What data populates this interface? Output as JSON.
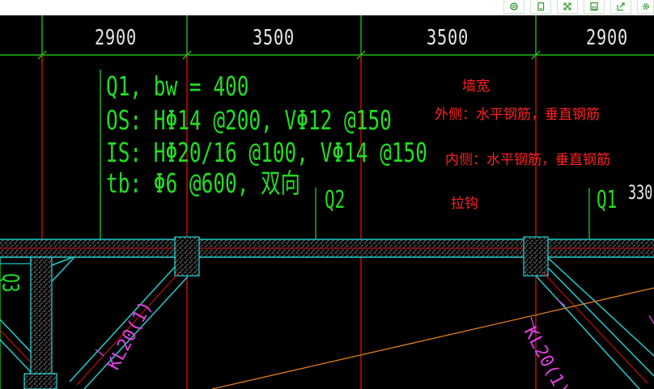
{
  "toolbar": {
    "buttons": [
      {
        "icon": "search-icon"
      },
      {
        "icon": "copy-icon"
      },
      {
        "icon": "expand-icon"
      },
      {
        "icon": "save-icon"
      },
      {
        "icon": "share-icon"
      },
      {
        "icon": "settings-icon"
      }
    ]
  },
  "dimensions": [
    "2900",
    "3500",
    "3500",
    "2900"
  ],
  "wall_spec": {
    "line1": "Q1, bw = 400",
    "line2": "OS: HΦ14 @200, VΦ12 @150",
    "line3": "IS: HΦ20/16 @100, VΦ14 @150",
    "line4": "tb: Φ6 @600, 双向"
  },
  "annotations": {
    "wall_width": "墙宽",
    "outer_side": "外侧：水平钢筋，垂直钢筋",
    "inner_side": "内侧：水平钢筋，垂直钢筋",
    "tie_bar": "拉钩"
  },
  "wall_tags": {
    "q2": "Q2",
    "q1": "Q1",
    "partial_dim": "330",
    "left_partial": "Q3"
  },
  "beam_tags": {
    "left": "KL20(1)",
    "right": "KL20(1)"
  },
  "colors": {
    "background": "#000000",
    "dimension_text": "#e8e8e8",
    "spec_text": "#22dd22",
    "annotation_text": "#ff2020",
    "axis_line": "#dd1010",
    "wall_outline": "#22cccc",
    "beam_tag": "#e040e0",
    "diagonal_line": "#e08020"
  }
}
